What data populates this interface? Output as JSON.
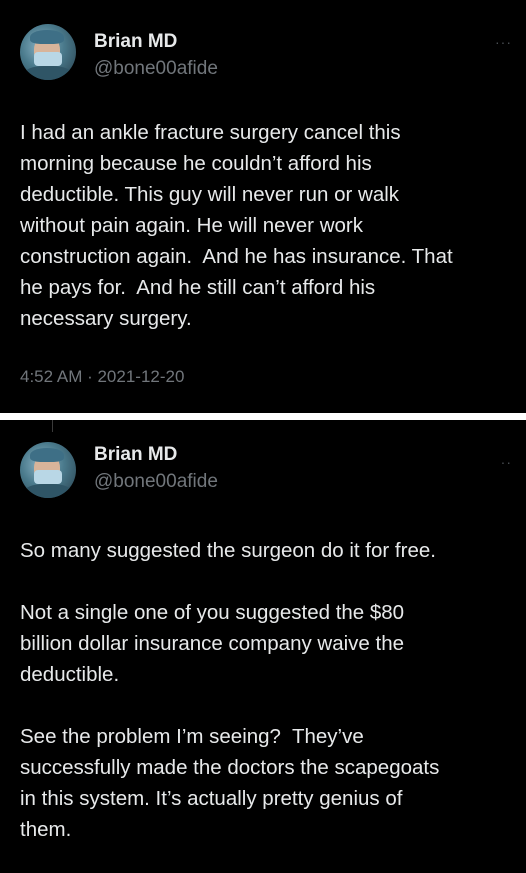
{
  "tweets": [
    {
      "author_name": "Brian MD",
      "handle": "@bone00afide",
      "text": "I had an ankle fracture surgery cancel this\nmorning because he couldn’t afford his\ndeductible. This guy will never run or walk\nwithout pain again. He will never work\nconstruction again.  And he has insurance. That\nhe pays for.  And he still can’t afford his\nnecessary surgery.",
      "timestamp": "4:52 AM · 2021-12-20",
      "more_icon": "more-dots-icon"
    },
    {
      "author_name": "Brian MD",
      "handle": "@bone00afide",
      "text": "So many suggested the surgeon do it for free.\n\nNot a single one of you suggested the $80\nbillion dollar insurance company waive the\ndeductible.\n\nSee the problem I’m seeing?  They’ve\nsuccessfully made the doctors the scapegoats\nin this system. It’s actually pretty genius of\nthem.",
      "more_icon": "more-dots-icon"
    }
  ],
  "colors": {
    "background": "#000000",
    "text": "#e7e9ea",
    "secondary_text": "#71767b",
    "divider": "#ffffff"
  }
}
